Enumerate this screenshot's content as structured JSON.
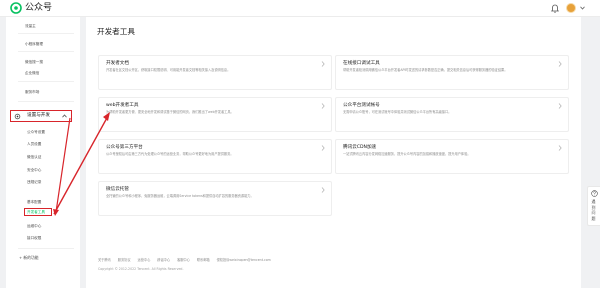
{
  "app": {
    "name": "公众号",
    "brand_color": "#07c160",
    "alert_color": "#d8252b"
  },
  "topbar": {
    "logo_icon": "wechat-official-logo",
    "bell_icon": "bell-icon",
    "avatar_color": "#e7a13a"
  },
  "sidebar": {
    "items": [
      {
        "label": "流量主"
      },
      {
        "label": "小程序管理"
      },
      {
        "label": "微信搜一搜"
      },
      {
        "label": "企业微信"
      },
      {
        "label": "服务市场"
      }
    ],
    "group": {
      "label": "设置与开发",
      "icon": "gear-icon"
    },
    "sub_items": [
      {
        "label": "公众号设置"
      },
      {
        "label": "人员设置"
      },
      {
        "label": "微信认证"
      },
      {
        "label": "安全中心"
      },
      {
        "label": "违规记录"
      },
      {
        "label": "基本配置"
      },
      {
        "label": "开发者工具"
      },
      {
        "label": "运维中心"
      },
      {
        "label": "接口权限"
      }
    ],
    "new_function": "+ 新的功能"
  },
  "main": {
    "title": "开发者工具",
    "cards": [
      {
        "title": "开发者文档",
        "desc": "开发者社区文档公开区，获取接口权限说明、可用能开发者文档等相关接入及说明信息。"
      },
      {
        "title": "在线接口调试工具",
        "desc": "帮助开发者检测调用微信公众平台开发者API时发送的请求参数是否正确，提交相关信息后可获得服务器的验证结果。"
      },
      {
        "title": "web开发者工具",
        "desc": "为帮助开发者更方便、更安全地开发和调试基于微信的网页，我们推出了web开发者工具。"
      },
      {
        "title": "公众平台测试帐号",
        "desc": "无需申请公众账号，可在测试帐号中体验并测试微信公众平台所有高级接口。"
      },
      {
        "title": "公众号第三方平台",
        "desc": "公众号授权后可由第三方代为处理公众号的运营业务，帮助公众号更好地为用户提供服务。"
      },
      {
        "title": "腾讯云CDN加速",
        "desc": "一站式腾讯云内容分发网络加速服务，提升公众号内容的加载和播放速度，提升用户体验。"
      },
      {
        "title": "微信云托管",
        "desc": "全托管的公众号和小程序，免服务器运维，云端调用Service tokens和提供自动扩容的服务器资源能力。"
      }
    ]
  },
  "footer": {
    "links": [
      "关于腾讯",
      "服务协议",
      "运营中心",
      "辟谣中心",
      "客服中心",
      "联系邮箱",
      "侵权投诉weixinopen@tencent.com"
    ],
    "copyright": "Copyright © 2012-2022 Tencent. All Rights Reserved."
  },
  "help": {
    "icon": "question-circle-icon",
    "label": "遇到问题"
  }
}
